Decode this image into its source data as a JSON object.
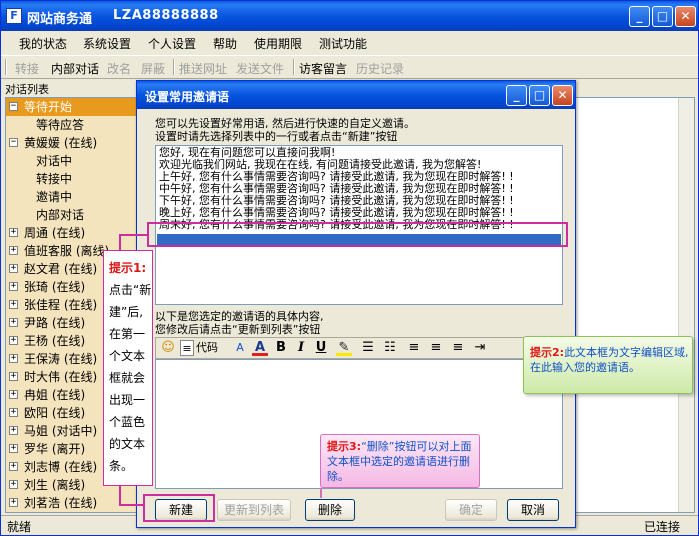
{
  "window": {
    "app_icon": "F",
    "title": "网站商务通",
    "account_id": "LZA88888888"
  },
  "menu": [
    "我的状态",
    "系统设置",
    "个人设置",
    "帮助",
    "使用期限",
    "测试功能"
  ],
  "toolbar": {
    "items": [
      {
        "label": "转接",
        "enabled": false
      },
      {
        "label": "内部对话",
        "enabled": true
      },
      {
        "label": "改名",
        "enabled": false
      },
      {
        "label": "屏蔽",
        "enabled": false
      },
      {
        "label": "推送网址",
        "enabled": false
      },
      {
        "label": "发送文件",
        "enabled": false
      },
      {
        "label": "访客留言",
        "enabled": true
      },
      {
        "label": "历史记录",
        "enabled": false
      }
    ]
  },
  "contact_list": {
    "header": "对话列表",
    "rows": [
      {
        "label": "等待开始",
        "level": 0,
        "expander": "−",
        "selected": true
      },
      {
        "label": "等待应答",
        "level": 1
      },
      {
        "label": "黄媛媛 (在线)",
        "level": 0,
        "expander": "−"
      },
      {
        "label": "对话中",
        "level": 1
      },
      {
        "label": "转接中",
        "level": 1
      },
      {
        "label": "邀请中",
        "level": 1
      },
      {
        "label": "内部对话",
        "level": 1
      },
      {
        "label": "周通 (在线)",
        "level": 0,
        "expander": "+"
      },
      {
        "label": "值班客服 (离线)",
        "level": 0,
        "expander": "+"
      },
      {
        "label": "赵文君 (在线)",
        "level": 0,
        "expander": "+"
      },
      {
        "label": "张琦 (在线)",
        "level": 0,
        "expander": "+"
      },
      {
        "label": "张佳程 (在线)",
        "level": 0,
        "expander": "+"
      },
      {
        "label": "尹路 (在线)",
        "level": 0,
        "expander": "+"
      },
      {
        "label": "王杨 (在线)",
        "level": 0,
        "expander": "+"
      },
      {
        "label": "王保涛 (在线)",
        "level": 0,
        "expander": "+"
      },
      {
        "label": "时大伟 (在线)",
        "level": 0,
        "expander": "+"
      },
      {
        "label": "冉姐 (在线)",
        "level": 0,
        "expander": "+"
      },
      {
        "label": "欧阳 (在线)",
        "level": 0,
        "expander": "+"
      },
      {
        "label": "马姐 (对话中)",
        "level": 0,
        "expander": "+"
      },
      {
        "label": "罗华 (离开)",
        "level": 0,
        "expander": "+"
      },
      {
        "label": "刘志博 (在线)",
        "level": 0,
        "expander": "+"
      },
      {
        "label": "刘生 (离线)",
        "level": 0,
        "expander": "+"
      },
      {
        "label": "刘茗浩 (在线)",
        "level": 0,
        "expander": "+"
      }
    ]
  },
  "status": {
    "left": "就绪",
    "right": "已连接"
  },
  "dialog": {
    "title": "设置常用邀请语",
    "desc_line1": "您可以先设置好常用语, 然后进行快速的自定义邀请。",
    "desc_line2": "设置时请先选择列表中的一行或者点击“新建”按钮",
    "phrases": [
      "您好, 现在有问题您可以直接问我啊!",
      "欢迎光临我们网站, 我现在在线, 有问题请接受此邀请, 我为您解答!",
      "上午好, 您有什么事情需要咨询吗? 请接受此邀请, 我为您现在即时解答! !",
      "中午好, 您有什么事情需要咨询吗? 请接受此邀请, 我为您现在即时解答! !",
      "下午好, 您有什么事情需要咨询吗? 请接受此邀请, 我为您现在即时解答! !",
      "晚上好, 您有什么事情需要咨询吗? 请接受此邀请, 我为您现在即时解答! !",
      "周末好, 您有什么事情需要咨询吗? 请接受此邀请, 我为您现在即时解答! !"
    ],
    "edit_line1": "以下是您选定的邀请语的具体内容,",
    "edit_line2": "您修改后请点击“更新到列表”按钮",
    "editor_code_label": "代码",
    "buttons": {
      "new": "新建",
      "update": "更新到列表",
      "delete": "删除",
      "ok": "确定",
      "cancel": "取消"
    }
  },
  "tips": {
    "tip1_title": "提示1:",
    "tip1_body": "点击“新建”后, 在第一个文本框就会出现一个蓝色的文本条。",
    "tip2_title": "提示2:",
    "tip2_body": "此文本框为文字编辑区域, 在此输入您的邀请语。",
    "tip3_title": "提示3:",
    "tip3_body": "“删除”按钮可以对上面文本框中选定的邀请语进行删除。"
  },
  "colors": {
    "titlebar_blue": "#0755df",
    "selection_blue": "#316ac5",
    "tip_red": "#e01515",
    "tip_text_blue": "#1050c8",
    "highlight_magenta": "#cc2ea0",
    "contact_panel_bg": "#f4e4be"
  }
}
